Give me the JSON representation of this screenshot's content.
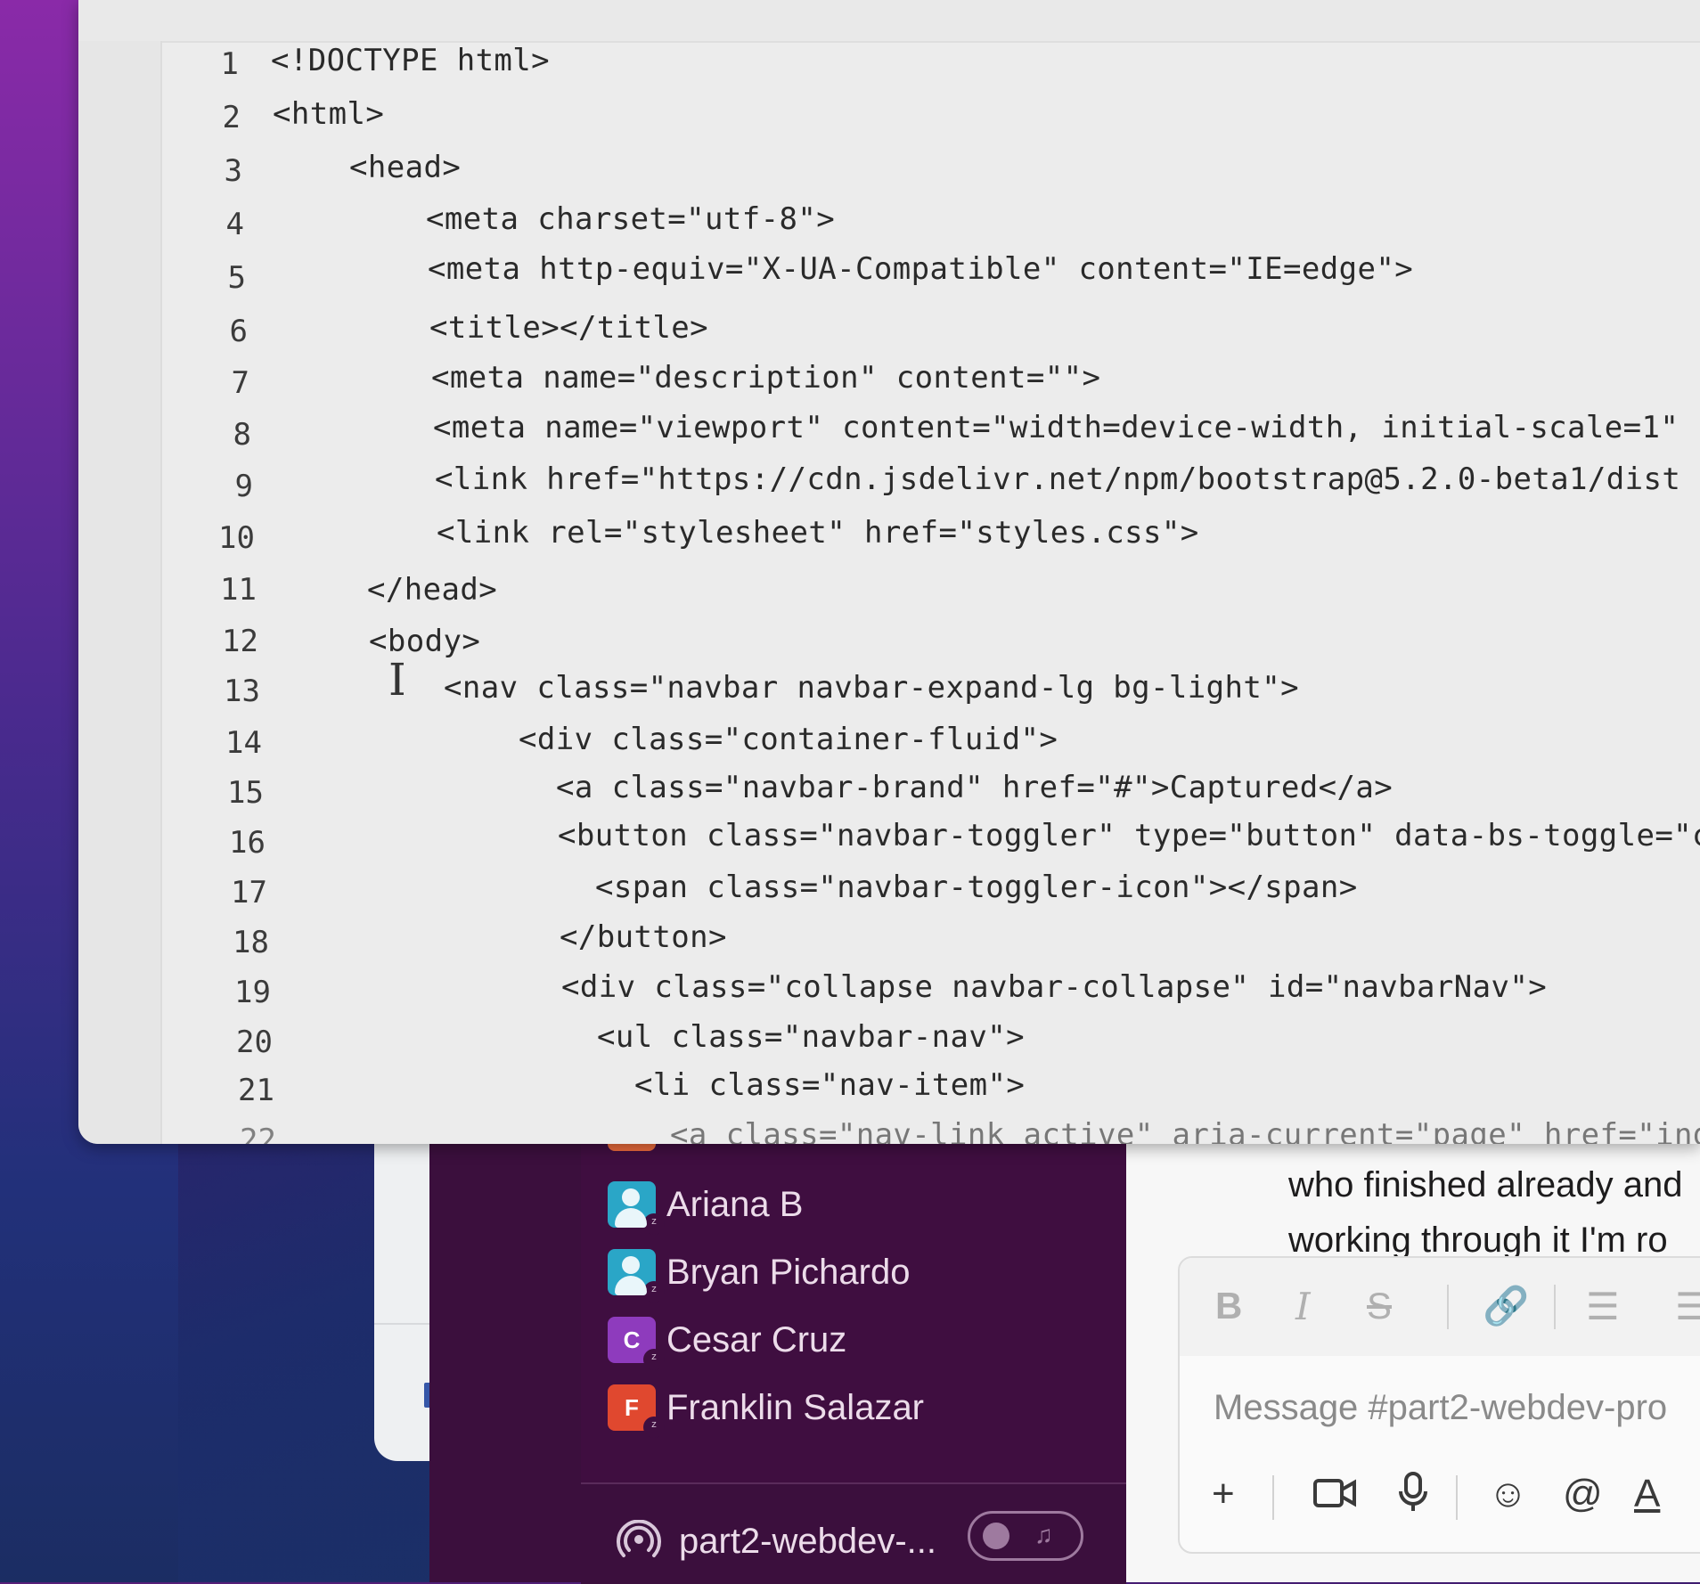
{
  "editor": {
    "lines": [
      {
        "num": "1",
        "code": "<!DOCTYPE html>"
      },
      {
        "num": "2",
        "code": "<html>"
      },
      {
        "num": "3",
        "code": "<head>"
      },
      {
        "num": "4",
        "code": "<meta charset=\"utf-8\">"
      },
      {
        "num": "5",
        "code": "<meta http-equiv=\"X-UA-Compatible\" content=\"IE=edge\">"
      },
      {
        "num": "6",
        "code": "<title></title>"
      },
      {
        "num": "7",
        "code": "<meta name=\"description\" content=\"\">"
      },
      {
        "num": "8",
        "code": "<meta name=\"viewport\" content=\"width=device-width, initial-scale=1\""
      },
      {
        "num": "9",
        "code": "<link href=\"https://cdn.jsdelivr.net/npm/bootstrap@5.2.0-beta1/dist"
      },
      {
        "num": "10",
        "code": "<link rel=\"stylesheet\" href=\"styles.css\">"
      },
      {
        "num": "11",
        "code": "</head>"
      },
      {
        "num": "12",
        "code": "<body>"
      },
      {
        "num": "13",
        "code": "<nav class=\"navbar navbar-expand-lg bg-light\">"
      },
      {
        "num": "14",
        "code": "<div class=\"container-fluid\">"
      },
      {
        "num": "15",
        "code": "<a class=\"navbar-brand\" href=\"#\">Captured</a>"
      },
      {
        "num": "16",
        "code": "<button class=\"navbar-toggler\" type=\"button\" data-bs-toggle=\"c"
      },
      {
        "num": "17",
        "code": "<span class=\"navbar-toggler-icon\"></span>"
      },
      {
        "num": "18",
        "code": "</button>"
      },
      {
        "num": "19",
        "code": "<div class=\"collapse navbar-collapse\" id=\"navbarNav\">"
      },
      {
        "num": "20",
        "code": "<ul class=\"navbar-nav\">"
      },
      {
        "num": "21",
        "code": "<li class=\"nav-item\">"
      },
      {
        "num": "22",
        "code": "<a class=\"nav-link active\" aria-current=\"page\" href=\"ind"
      }
    ]
  },
  "slack": {
    "dms": [
      {
        "name": "Ariana B",
        "avatar": ""
      },
      {
        "name": "Bryan Pichardo",
        "avatar": ""
      },
      {
        "name": "Cesar Cruz",
        "avatar": "C"
      },
      {
        "name": "Franklin Salazar",
        "avatar": "F"
      }
    ],
    "status_glyph": "ᶻ",
    "huddle": {
      "channel": "part2-webdev-..."
    },
    "messages": [
      "who finished already and",
      "working through it I'm ro"
    ],
    "composer": {
      "placeholder": "Message #part2-webdev-pro",
      "format_buttons": [
        "B",
        "I",
        "S"
      ]
    }
  },
  "colors": {
    "slack_sidebar": "#3f0e40",
    "editor_bg": "#ececec",
    "accent_red": "#e0482f",
    "accent_purple": "#8e3bbd",
    "accent_cyan": "#2aa6c7"
  }
}
